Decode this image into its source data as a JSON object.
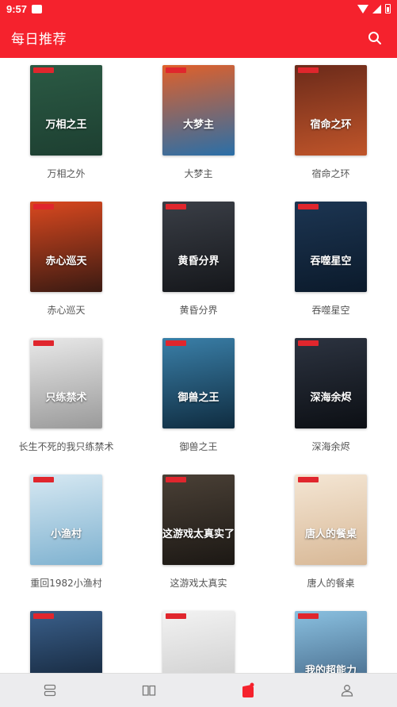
{
  "status_bar": {
    "time": "9:57"
  },
  "app_bar": {
    "title": "每日推荐"
  },
  "books": [
    {
      "label": "万相之外",
      "cover_text": "万相之王",
      "colors": [
        "#2b5a44",
        "#1d3f31"
      ]
    },
    {
      "label": "大梦主",
      "cover_text": "大梦主",
      "colors": [
        "#e0602a",
        "#2a6fa8"
      ]
    },
    {
      "label": "宿命之环",
      "cover_text": "宿命之环",
      "colors": [
        "#6b2a1a",
        "#c0552a"
      ]
    },
    {
      "label": "赤心巡天",
      "cover_text": "赤心巡天",
      "colors": [
        "#d9481f",
        "#3a1a12"
      ]
    },
    {
      "label": "黄昏分界",
      "cover_text": "黄昏分界",
      "colors": [
        "#3a3e46",
        "#15171b"
      ]
    },
    {
      "label": "吞噬星空",
      "cover_text": "吞噬星空",
      "colors": [
        "#1c3552",
        "#0b1a2b"
      ]
    },
    {
      "label": "长生不死的我只练禁术",
      "cover_text": "只练禁术",
      "colors": [
        "#e8e8e8",
        "#9a9a9a"
      ]
    },
    {
      "label": "御兽之王",
      "cover_text": "御兽之王",
      "colors": [
        "#3a7fa8",
        "#0f2c40"
      ]
    },
    {
      "label": "深海余烬",
      "cover_text": "深海余烬",
      "colors": [
        "#2c3340",
        "#0c0f14"
      ]
    },
    {
      "label": "重回1982小渔村",
      "cover_text": "小渔村",
      "colors": [
        "#d6e8f2",
        "#7fb2d0"
      ]
    },
    {
      "label": "这游戏太真实",
      "cover_text": "这游戏太真实了",
      "colors": [
        "#4a4036",
        "#1c1814"
      ]
    },
    {
      "label": "唐人的餐桌",
      "cover_text": "唐人的餐桌",
      "colors": [
        "#f4e6d4",
        "#d8b896"
      ]
    },
    {
      "label": "",
      "cover_text": "",
      "colors": [
        "#3a5f8a",
        "#0d1a2a"
      ]
    },
    {
      "label": "",
      "cover_text": "",
      "colors": [
        "#f2f2f2",
        "#c8c8c8"
      ]
    },
    {
      "label": "",
      "cover_text": "我的超能力",
      "colors": [
        "#8ac0e0",
        "#3a5a7a"
      ]
    }
  ],
  "accent": "#f5222d"
}
